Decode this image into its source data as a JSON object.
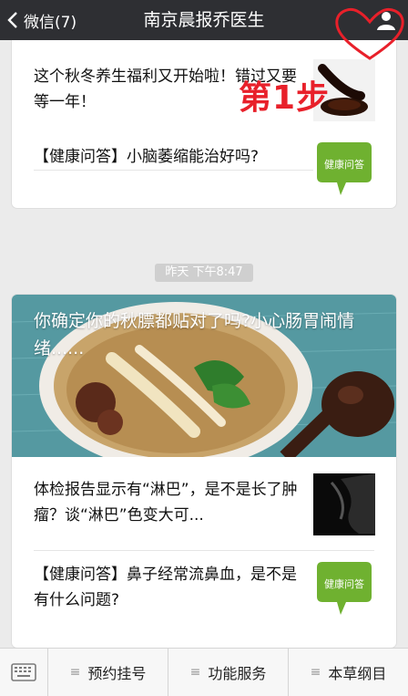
{
  "header": {
    "back_label": "微信(7)",
    "title": "南京晨报乔医生"
  },
  "overlay": {
    "step_label": "第1步"
  },
  "cards": [
    {
      "items": [
        {
          "title": "这个秋冬养生福利又开始啦！错过又要等一年！",
          "thumb": "sauce-spoon-icon"
        },
        {
          "title": "【健康问答】小脑萎缩能治好吗?",
          "thumb": "health-qa-bubble-icon",
          "thumb_text": "健康问答"
        }
      ]
    },
    {
      "hero_title": "你确定你的秋膘都贴对了吗?小心肠胃闹情绪......",
      "items": [
        {
          "title": "体检报告显示有“淋巴”，是不是长了肿瘤？谈“淋巴”色变大可...",
          "thumb": "dark-figure-icon"
        },
        {
          "title": "【健康问答】鼻子经常流鼻血，是不是有什么问题?",
          "thumb": "health-qa-bubble-icon",
          "thumb_text": "健康问答"
        }
      ]
    }
  ],
  "timestamp": "昨天 下午8:47",
  "menu": {
    "items": [
      "预约挂号",
      "功能服务",
      "本草纲目"
    ]
  }
}
